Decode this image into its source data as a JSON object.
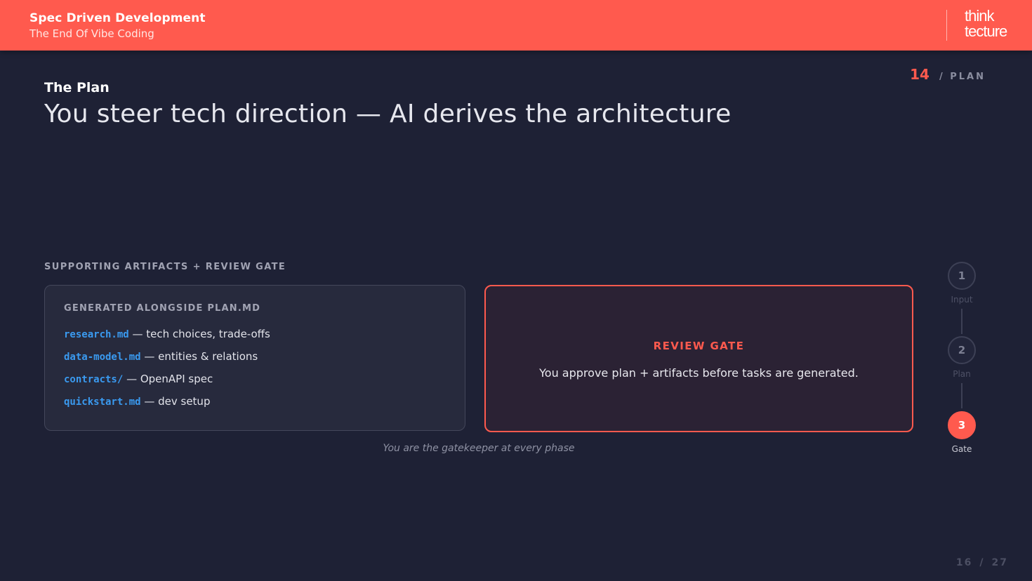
{
  "header": {
    "deck_title": "Spec Driven Development",
    "deck_subtitle": "The End Of Vibe Coding",
    "logo_line1": "think",
    "logo_line2": "tecture"
  },
  "phase": {
    "number": "14",
    "label": "/ PLAN"
  },
  "slide": {
    "kicker": "The Plan",
    "headline": "You steer tech direction — AI derives the architecture",
    "section_label": "SUPPORTING ARTIFACTS + REVIEW GATE"
  },
  "artifacts": {
    "title": "GENERATED ALONGSIDE PLAN.MD",
    "items": [
      {
        "file": "research.md",
        "desc": " — tech choices, trade-offs"
      },
      {
        "file": "data-model.md",
        "desc": " — entities & relations"
      },
      {
        "file": "contracts/",
        "desc": " — OpenAPI spec"
      },
      {
        "file": "quickstart.md",
        "desc": " — dev setup"
      }
    ]
  },
  "review_gate": {
    "title": "REVIEW GATE",
    "text": "You approve plan + artifacts before tasks are generated."
  },
  "caption": "You are the gatekeeper at every phase",
  "stepper": {
    "steps": [
      {
        "num": "1",
        "label": "Input",
        "active": false
      },
      {
        "num": "2",
        "label": "Plan",
        "active": false
      },
      {
        "num": "3",
        "label": "Gate",
        "active": true
      }
    ]
  },
  "pagination": {
    "current": "16",
    "separator": "/",
    "total": "27"
  },
  "colors": {
    "accent": "#ff5a4e",
    "background": "#1e2135",
    "code": "#3a9af0"
  }
}
